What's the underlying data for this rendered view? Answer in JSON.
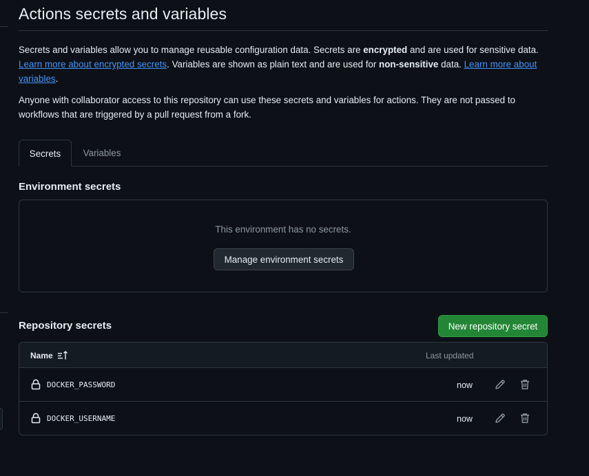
{
  "page": {
    "title": "Actions secrets and variables"
  },
  "intro": {
    "text1": "Secrets and variables allow you to manage reusable configuration data. Secrets are ",
    "bold1": "encrypted",
    "text2": " and are used for sensitive data. ",
    "link1": "Learn more about encrypted secrets",
    "text3": ". Variables are shown as plain text and are used for ",
    "bold2": "non-sensitive",
    "text4": " data. ",
    "link2": "Learn more about variables",
    "text5": "."
  },
  "access_note": "Anyone with collaborator access to this repository can use these secrets and variables for actions. They are not passed to workflows that are triggered by a pull request from a fork.",
  "tabs": [
    {
      "label": "Secrets",
      "selected": true
    },
    {
      "label": "Variables",
      "selected": false
    }
  ],
  "environment_secrets": {
    "title": "Environment secrets",
    "empty_text": "This environment has no secrets.",
    "manage_button": "Manage environment secrets"
  },
  "repository_secrets": {
    "title": "Repository secrets",
    "new_button": "New repository secret",
    "columns": {
      "name": "Name",
      "last_updated": "Last updated"
    },
    "rows": [
      {
        "name": "DOCKER_PASSWORD",
        "updated": "now"
      },
      {
        "name": "DOCKER_USERNAME",
        "updated": "now"
      }
    ]
  },
  "colors": {
    "background": "#0d1117",
    "border": "#30363d",
    "link": "#4493f8",
    "primary_button": "#238636",
    "muted_text": "#9198a1"
  },
  "icons": {
    "sort": "sort-ascending-icon",
    "lock": "lock-icon",
    "edit": "pencil-icon",
    "delete": "trash-icon"
  }
}
